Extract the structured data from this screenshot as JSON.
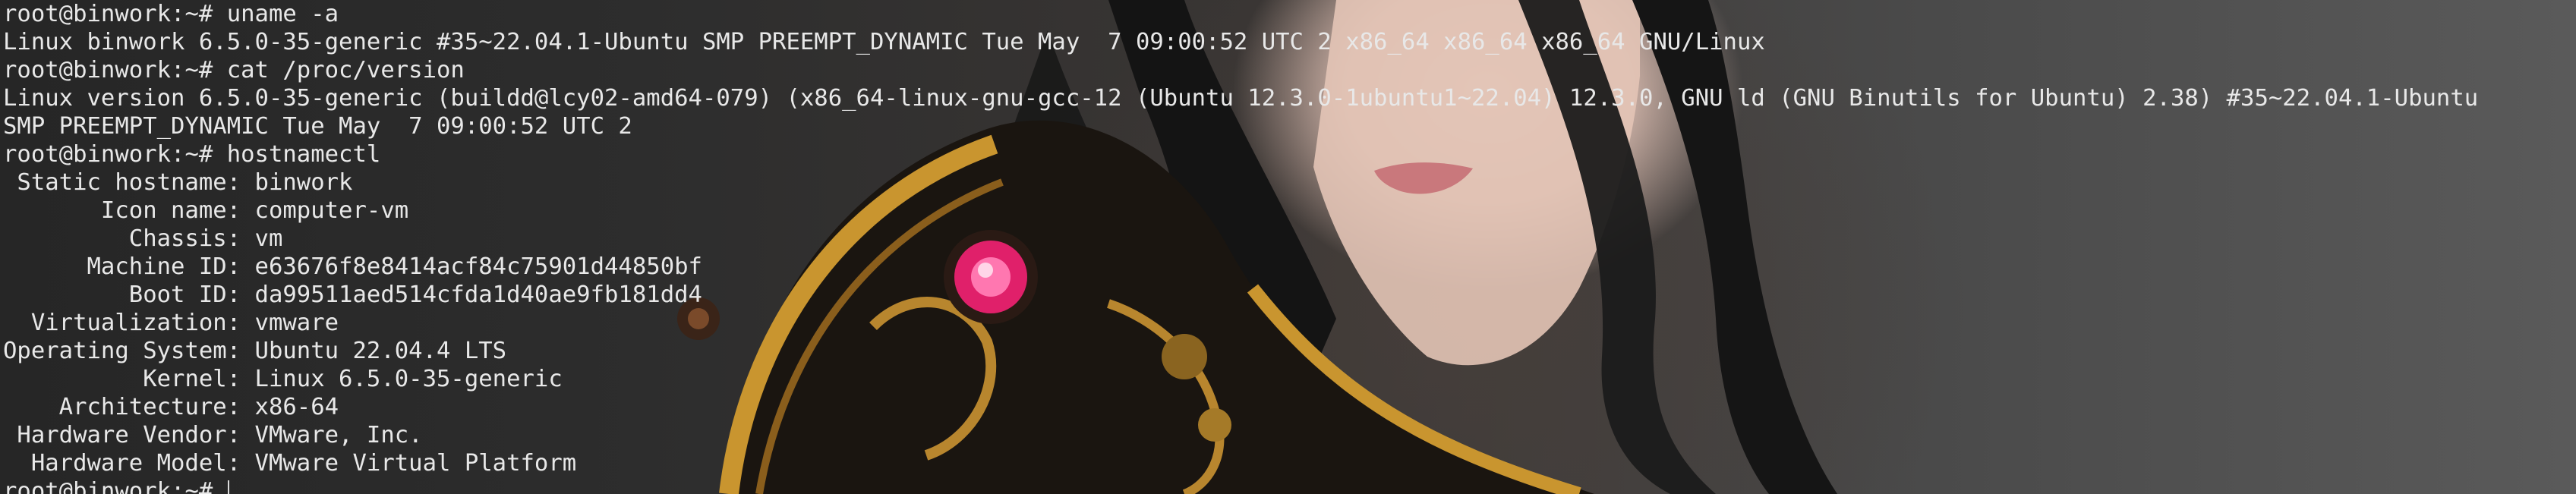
{
  "terminal": {
    "lines": [
      "root@binwork:~# uname -a",
      "Linux binwork 6.5.0-35-generic #35~22.04.1-Ubuntu SMP PREEMPT_DYNAMIC Tue May  7 09:00:52 UTC 2 x86_64 x86_64 x86_64 GNU/Linux",
      "root@binwork:~# cat /proc/version",
      "Linux version 6.5.0-35-generic (buildd@lcy02-amd64-079) (x86_64-linux-gnu-gcc-12 (Ubuntu 12.3.0-1ubuntu1~22.04) 12.3.0, GNU ld (GNU Binutils for Ubuntu) 2.38) #35~22.04.1-Ubuntu",
      "SMP PREEMPT_DYNAMIC Tue May  7 09:00:52 UTC 2",
      "root@binwork:~# hostnamectl",
      " Static hostname: binwork",
      "       Icon name: computer-vm",
      "         Chassis: vm",
      "      Machine ID: e63676f8e8414acf84c75901d44850bf",
      "         Boot ID: da99511aed514cfda1d40ae9fb181dd4",
      "  Virtualization: vmware",
      "Operating System: Ubuntu 22.04.4 LTS",
      "          Kernel: Linux 6.5.0-35-generic",
      "    Architecture: x86-64",
      " Hardware Vendor: VMware, Inc.",
      "  Hardware Model: VMware Virtual Platform",
      "root@binwork:~# "
    ]
  },
  "colors": {
    "text": "#e8e8e8",
    "background": "#2d2d2d",
    "orb": "#e0206a",
    "gold": "#b8862e"
  }
}
